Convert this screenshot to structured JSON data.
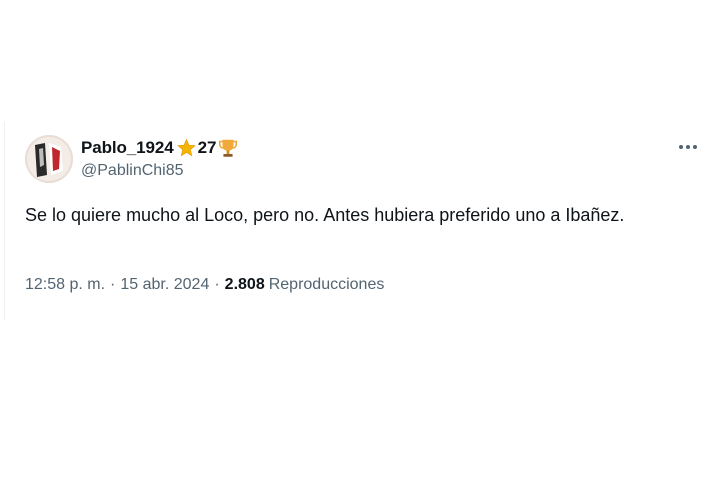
{
  "tweet": {
    "author": {
      "display_name": "Pablo_1924",
      "name_number": "27",
      "name_emojis": [
        "star-icon",
        "trophy-icon"
      ],
      "handle": "@PablinChi85"
    },
    "text": "Se lo quiere mucho al Loco, pero no. Antes hubiera preferido uno a Ibañez.",
    "time": "12:58 p. m.",
    "separator": "·",
    "date": "15 abr. 2024",
    "views": "2.808",
    "views_label": "Reproducciones",
    "more_icon": "more-icon"
  },
  "colors": {
    "text_primary": "#0f1419",
    "text_secondary": "#536471",
    "star": "#f4b400",
    "trophy": "#f2a93b"
  }
}
